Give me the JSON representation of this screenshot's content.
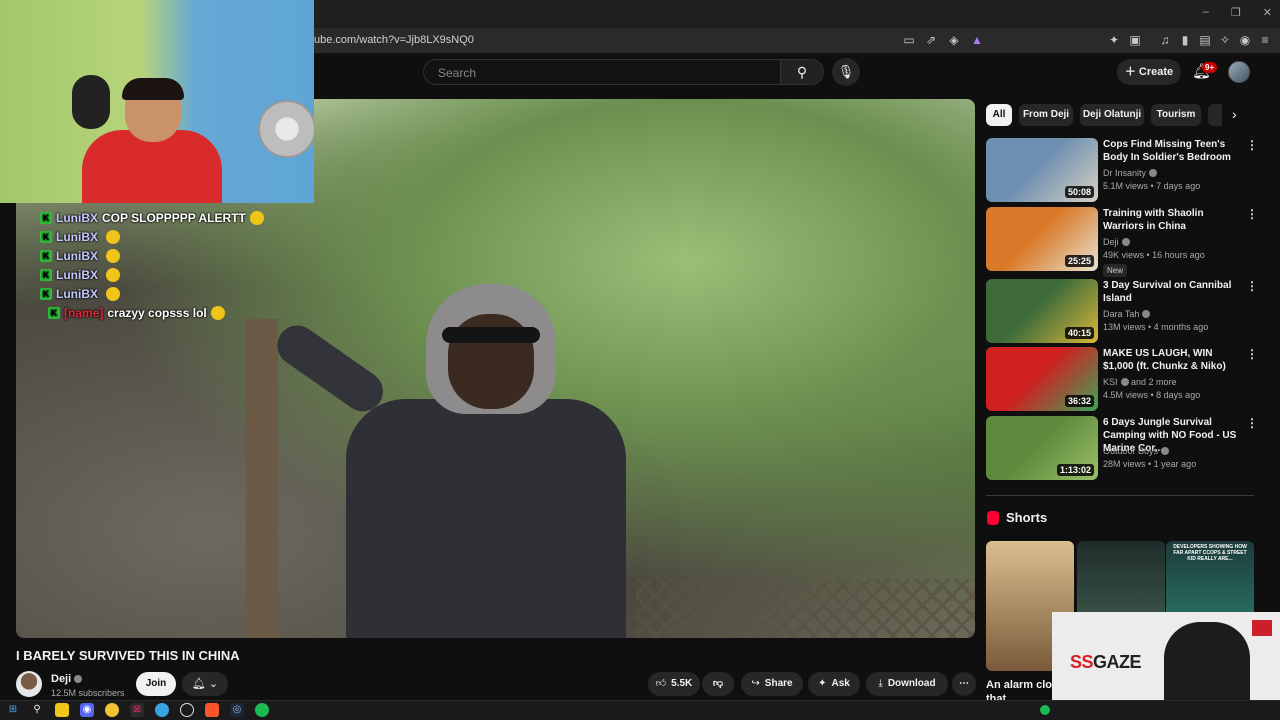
{
  "browser": {
    "url": "ube.com/watch?v=Jjb8LX9sNQ0",
    "window_controls": [
      "–",
      "❐",
      "✕"
    ]
  },
  "header": {
    "search_placeholder": "Search",
    "create_label": "Create",
    "notif_count": "9+"
  },
  "chat": [
    {
      "user": "LuniBX",
      "message": "COP SLOPPPPP ALERTT",
      "red": false
    },
    {
      "user": "LuniBX",
      "message": "",
      "red": false
    },
    {
      "user": "LuniBX",
      "message": "",
      "red": false
    },
    {
      "user": "LuniBX",
      "message": "",
      "red": false
    },
    {
      "user": "LuniBX",
      "message": "",
      "red": false
    },
    {
      "user": "[name]",
      "message": "crazyy copsss lol",
      "red": true
    }
  ],
  "video": {
    "title": "I BARELY SURVIVED THIS IN CHINA",
    "channel": "Deji",
    "subscribers": "12.5M subscribers",
    "join_label": "Join",
    "likes": "5.5K",
    "share_label": "Share",
    "ask_label": "Ask",
    "download_label": "Download"
  },
  "chips": [
    "All",
    "From Deji",
    "Deji Olatunji",
    "Tourism"
  ],
  "related": [
    {
      "title": "Cops Find Missing Teen's Body In Soldier's Bedroom",
      "channel": "Dr Insanity",
      "meta": "5.1M views • 7 days ago",
      "duration": "50:08",
      "badge": "",
      "colors": [
        "#6d8fb0",
        "#d8d1c4"
      ]
    },
    {
      "title": "Training with Shaolin Warriors in China",
      "channel": "Deji",
      "meta": "49K views • 16 hours ago",
      "duration": "25:25",
      "badge": "New",
      "colors": [
        "#d97a2b",
        "#e9e2d0"
      ]
    },
    {
      "title": "3 Day Survival on Cannibal Island",
      "channel": "Dara Tah",
      "meta": "13M views • 4 months ago",
      "duration": "40:15",
      "badge": "",
      "colors": [
        "#3f6b3a",
        "#d8b83a"
      ]
    },
    {
      "title": "MAKE US LAUGH, WIN $1,000 (ft. Chunkz & Niko)",
      "channel": "KSI",
      "channel_extra": "and 2 more",
      "meta": "4.5M views • 8 days ago",
      "duration": "36:32",
      "badge": "",
      "colors": [
        "#d02020",
        "#3fa35a"
      ]
    },
    {
      "title": "6 Days Jungle Survival Camping with NO Food - US Marine Cor...",
      "channel": "Outdoor Boys",
      "meta": "28M views • 1 year ago",
      "duration": "1:13:02",
      "badge": "",
      "colors": [
        "#5d8a3c",
        "#9bbf68"
      ]
    }
  ],
  "shorts": {
    "heading": "Shorts",
    "caption": "An alarm clock that",
    "items": [
      {
        "text": "",
        "colors": [
          "#d9c08f",
          "#7a5a3a"
        ]
      },
      {
        "text": "",
        "colors": [
          "#1f2d2a",
          "#4a6b5a"
        ]
      },
      {
        "text": "DEVELOPERS SHOWING HOW FAR APART CCOPS & STREET KID REALLY ARE...",
        "colors": [
          "#1d3b3a",
          "#2f8f7f"
        ]
      }
    ]
  },
  "pip": {
    "logo_ss": "SS",
    "logo_rest": "GAZE"
  }
}
